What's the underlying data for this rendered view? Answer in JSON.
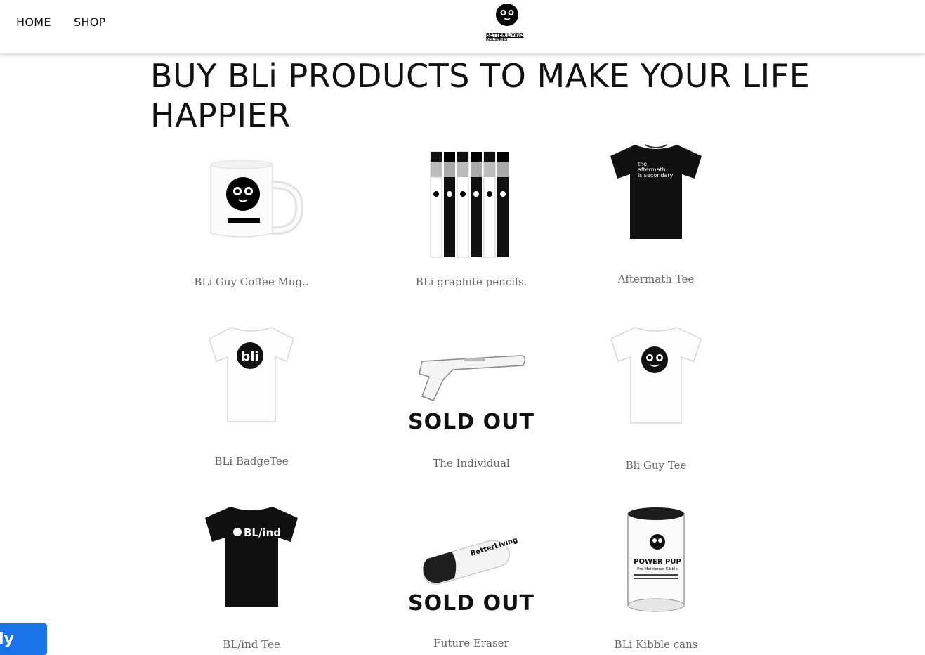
{
  "nav": {
    "home": "HOME",
    "shop": "SHOP"
  },
  "logo": {
    "name": "BETTER LIVING",
    "line2": "INDUSTRIES"
  },
  "page": {
    "title": "BUY BLi PRODUCTS TO MAKE YOUR LIFE HAPPIER"
  },
  "products": [
    {
      "name": "BLi Guy Coffee Mug..",
      "icon": "coffee-mug"
    },
    {
      "name": "BLi graphite pencils.",
      "icon": "pencils"
    },
    {
      "name": "Aftermath Tee",
      "icon": "black-tshirt",
      "print": [
        "the",
        "aftermath",
        "is secondary"
      ]
    },
    {
      "name": "BLi BadgeTee",
      "icon": "white-tshirt",
      "print": "bli"
    },
    {
      "name": "The Individual",
      "icon": "ray-gun",
      "badge": "SOLD OUT"
    },
    {
      "name": "Bli Guy Tee",
      "icon": "white-tshirt-face"
    },
    {
      "name": "BL/ind Tee",
      "icon": "black-tshirt",
      "print": "BL/ind"
    },
    {
      "name": "Future Eraser",
      "icon": "eraser",
      "badge": "SOLD OUT",
      "print": "BetterLiving"
    },
    {
      "name": "BLi Kibble cans",
      "icon": "can",
      "print": [
        "POWER PUP",
        "Pre-Moistened Kibble"
      ]
    }
  ],
  "widget": {
    "label": "ly"
  },
  "colors": {
    "accent": "#1a73e8",
    "text": "#111111",
    "product_name": "#666666"
  }
}
